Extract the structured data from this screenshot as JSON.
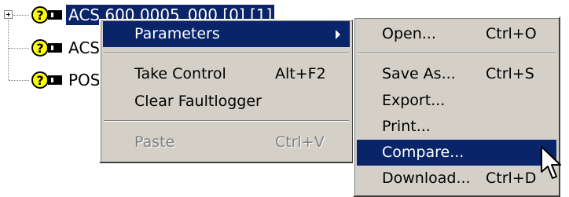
{
  "tree": {
    "nodes": [
      {
        "label": "ACS 600 0005_000 [0] [1]",
        "selected": true
      },
      {
        "label": "ACS",
        "selected": false
      },
      {
        "label": "POS",
        "selected": false
      }
    ]
  },
  "context_menu": {
    "parameters": "Parameters",
    "take_control": "Take Control",
    "take_control_shortcut": "Alt+F2",
    "clear_faultlogger": "Clear Faultlogger",
    "paste": "Paste",
    "paste_shortcut": "Ctrl+V"
  },
  "submenu": {
    "open": "Open...",
    "open_shortcut": "Ctrl+O",
    "save_as": "Save As...",
    "save_as_shortcut": "Ctrl+S",
    "export": "Export...",
    "print": "Print...",
    "compare": "Compare...",
    "download": "Download...",
    "download_shortcut": "Ctrl+D"
  },
  "colors": {
    "menu_bg": "#d4d0c8",
    "highlight": "#0a246a",
    "icon_yellow": "#ffff00"
  },
  "icons": [
    "expand-plus-icon",
    "drive-question-icon",
    "submenu-arrow-icon",
    "mouse-cursor-icon"
  ]
}
